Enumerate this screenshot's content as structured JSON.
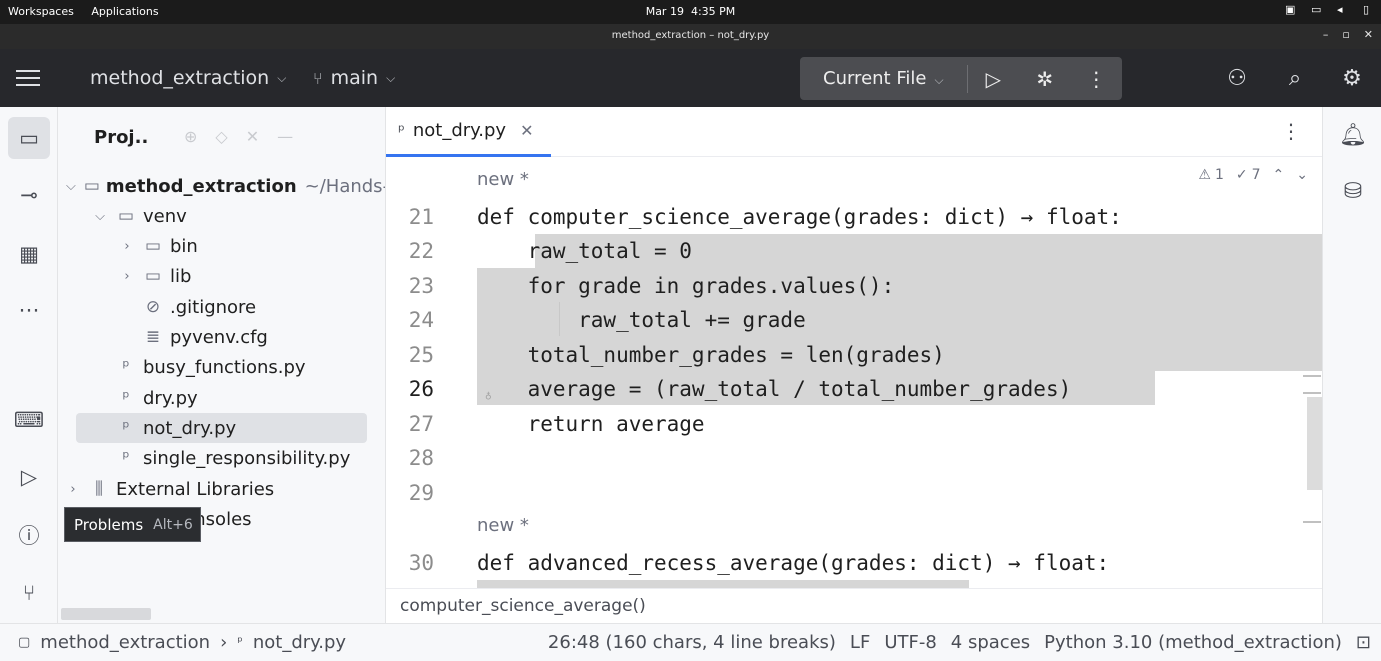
{
  "os_bar": {
    "workspaces": "Workspaces",
    "applications": "Applications",
    "date": "Mar 19",
    "time": "4:35 PM"
  },
  "window": {
    "title": "method_extraction – not_dry.py"
  },
  "toolbar": {
    "project_name": "method_extraction",
    "branch": "main",
    "run_config": "Current File"
  },
  "project_panel": {
    "title": "Proj..",
    "tree": {
      "root": "method_extraction",
      "root_path": "~/Hands-",
      "venv": "venv",
      "bin": "bin",
      "lib": "lib",
      "gitignore": ".gitignore",
      "pyvenv": "pyvenv.cfg",
      "file1": "busy_functions.py",
      "file2": "dry.py",
      "file3": "not_dry.py",
      "file4": "single_responsibility.py",
      "external": "External Libraries",
      "scratches": "Scratches and Consoles",
      "scratches_visible": "s and Consoles"
    }
  },
  "tooltip": {
    "label": "Problems",
    "shortcut": "Alt+6"
  },
  "editor": {
    "tab_label": "not_dry.py",
    "warnings": "1",
    "weak_warnings": "7",
    "hint1": "new *",
    "hint2": "new *",
    "lines": [
      {
        "n": "21",
        "t": "def computer_science_average(grades: dict) → float:"
      },
      {
        "n": "22",
        "t": "    raw_total = 0"
      },
      {
        "n": "23",
        "t": "    for grade in grades.values():"
      },
      {
        "n": "24",
        "t": "        raw_total += grade"
      },
      {
        "n": "25",
        "t": "    total_number_grades = len(grades)"
      },
      {
        "n": "26",
        "t": "    average = (raw_total / total_number_grades)"
      },
      {
        "n": "27",
        "t": "    return average"
      },
      {
        "n": "28",
        "t": ""
      },
      {
        "n": "29",
        "t": ""
      },
      {
        "n": "30",
        "t": "def advanced_recess_average(grades: dict) → float:"
      }
    ],
    "breadcrumb_function": "computer_science_average()"
  },
  "status_bar": {
    "crumb_project": "method_extraction",
    "crumb_file": "not_dry.py",
    "position": "26:48 (160 chars, 4 line breaks)",
    "line_sep": "LF",
    "encoding": "UTF-8",
    "indent": "4 spaces",
    "interpreter": "Python 3.10 (method_extraction)"
  },
  "icons": {
    "menu": "hamburger-icon",
    "branch": "branch-icon",
    "run": "play-icon",
    "debug": "bug-icon",
    "more": "kebab-icon",
    "add_user": "add-user-icon",
    "search": "search-icon",
    "settings": "gear-icon",
    "notifications": "bell-icon",
    "database": "database-icon"
  },
  "colors": {
    "toolbar_bg": "#27282c",
    "selection": "#d6d6d6",
    "tab_underline": "#3574f0",
    "caret_line": "#f5f8fe"
  }
}
